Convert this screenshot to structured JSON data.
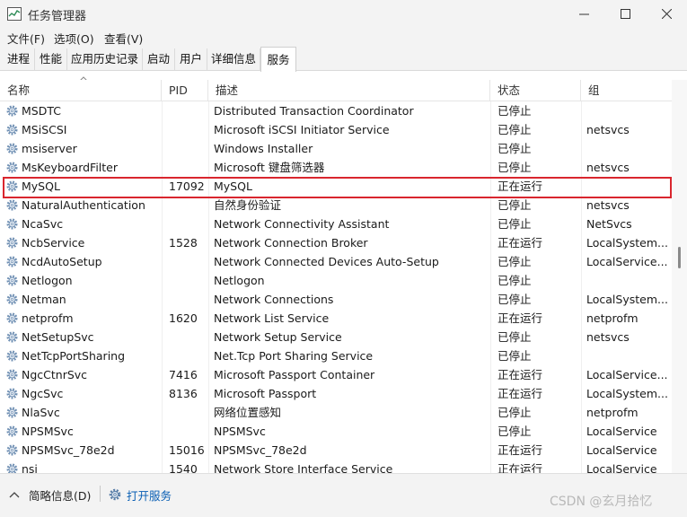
{
  "window": {
    "title": "任务管理器"
  },
  "menu": [
    "文件(F)",
    "选项(O)",
    "查看(V)"
  ],
  "tabs": [
    "进程",
    "性能",
    "应用历史记录",
    "启动",
    "用户",
    "详细信息",
    "服务"
  ],
  "active_tab": "服务",
  "columns": {
    "name": "名称",
    "pid": "PID",
    "desc": "描述",
    "status": "状态",
    "group": "组"
  },
  "rows": [
    {
      "name": "MSDTC",
      "pid": "",
      "desc": "Distributed Transaction Coordinator",
      "status": "已停止",
      "group": ""
    },
    {
      "name": "MSiSCSI",
      "pid": "",
      "desc": "Microsoft iSCSI Initiator Service",
      "status": "已停止",
      "group": "netsvcs"
    },
    {
      "name": "msiserver",
      "pid": "",
      "desc": "Windows Installer",
      "status": "已停止",
      "group": ""
    },
    {
      "name": "MsKeyboardFilter",
      "pid": "",
      "desc": "Microsoft 键盘筛选器",
      "status": "已停止",
      "group": "netsvcs"
    },
    {
      "name": "MySQL",
      "pid": "17092",
      "desc": "MySQL",
      "status": "正在运行",
      "group": ""
    },
    {
      "name": "NaturalAuthentication",
      "pid": "",
      "desc": "自然身份验证",
      "status": "已停止",
      "group": "netsvcs"
    },
    {
      "name": "NcaSvc",
      "pid": "",
      "desc": "Network Connectivity Assistant",
      "status": "已停止",
      "group": "NetSvcs"
    },
    {
      "name": "NcbService",
      "pid": "1528",
      "desc": "Network Connection Broker",
      "status": "正在运行",
      "group": "LocalSystem..."
    },
    {
      "name": "NcdAutoSetup",
      "pid": "",
      "desc": "Network Connected Devices Auto-Setup",
      "status": "已停止",
      "group": "LocalService..."
    },
    {
      "name": "Netlogon",
      "pid": "",
      "desc": "Netlogon",
      "status": "已停止",
      "group": ""
    },
    {
      "name": "Netman",
      "pid": "",
      "desc": "Network Connections",
      "status": "已停止",
      "group": "LocalSystem..."
    },
    {
      "name": "netprofm",
      "pid": "1620",
      "desc": "Network List Service",
      "status": "正在运行",
      "group": "netprofm"
    },
    {
      "name": "NetSetupSvc",
      "pid": "",
      "desc": "Network Setup Service",
      "status": "已停止",
      "group": "netsvcs"
    },
    {
      "name": "NetTcpPortSharing",
      "pid": "",
      "desc": "Net.Tcp Port Sharing Service",
      "status": "已停止",
      "group": ""
    },
    {
      "name": "NgcCtnrSvc",
      "pid": "7416",
      "desc": "Microsoft Passport Container",
      "status": "正在运行",
      "group": "LocalService..."
    },
    {
      "name": "NgcSvc",
      "pid": "8136",
      "desc": "Microsoft Passport",
      "status": "正在运行",
      "group": "LocalSystem..."
    },
    {
      "name": "NlaSvc",
      "pid": "",
      "desc": "网络位置感知",
      "status": "已停止",
      "group": "netprofm"
    },
    {
      "name": "NPSMSvc",
      "pid": "",
      "desc": "NPSMSvc",
      "status": "已停止",
      "group": "LocalService"
    },
    {
      "name": "NPSMSvc_78e2d",
      "pid": "15016",
      "desc": "NPSMSvc_78e2d",
      "status": "正在运行",
      "group": "LocalService"
    },
    {
      "name": "nsi",
      "pid": "1540",
      "desc": "Network Store Interface Service",
      "status": "正在运行",
      "group": "LocalService"
    }
  ],
  "footer": {
    "less_details": "简略信息(D)",
    "open_services": "打开服务",
    "watermark": "CSDN @玄月拾忆"
  },
  "colors": {
    "highlight_border": "#d9262e",
    "link": "#0a5fb4"
  }
}
